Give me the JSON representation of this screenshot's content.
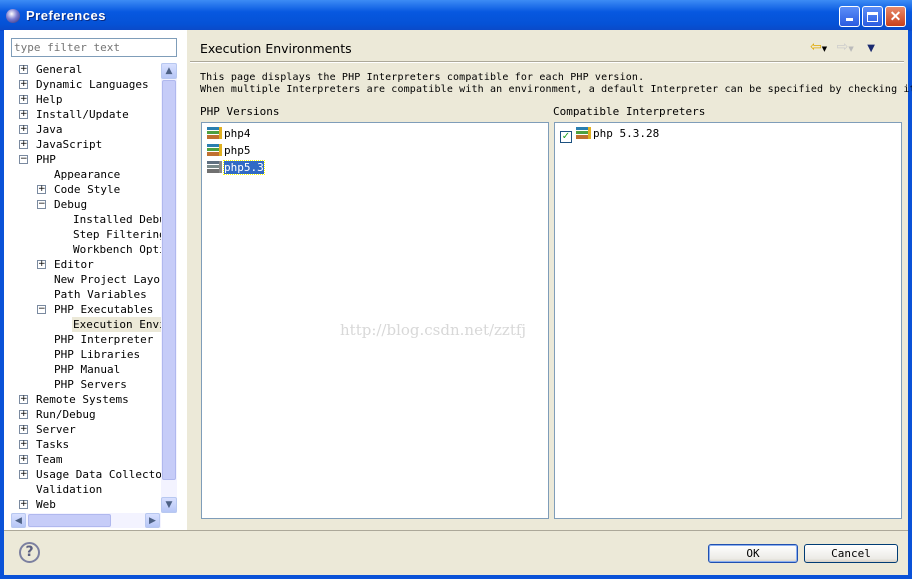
{
  "window": {
    "title": "Preferences",
    "minimize_icon": "minimize-icon",
    "maximize_icon": "maximize-icon",
    "close_icon": "close-icon"
  },
  "sidebar": {
    "filter_placeholder": "type filter text",
    "items": [
      {
        "label": "General",
        "level": 0,
        "expander": "+"
      },
      {
        "label": "Dynamic Languages",
        "level": 0,
        "expander": "+"
      },
      {
        "label": "Help",
        "level": 0,
        "expander": "+"
      },
      {
        "label": "Install/Update",
        "level": 0,
        "expander": "+"
      },
      {
        "label": "Java",
        "level": 0,
        "expander": "+"
      },
      {
        "label": "JavaScript",
        "level": 0,
        "expander": "+"
      },
      {
        "label": "PHP",
        "level": 0,
        "expander": "-"
      },
      {
        "label": "Appearance",
        "level": 1,
        "expander": ""
      },
      {
        "label": "Code Style",
        "level": 1,
        "expander": "+"
      },
      {
        "label": "Debug",
        "level": 1,
        "expander": "-"
      },
      {
        "label": "Installed Debuggers",
        "level": 2,
        "expander": ""
      },
      {
        "label": "Step Filtering",
        "level": 2,
        "expander": ""
      },
      {
        "label": "Workbench Options",
        "level": 2,
        "expander": ""
      },
      {
        "label": "Editor",
        "level": 1,
        "expander": "+"
      },
      {
        "label": "New Project Layout",
        "level": 1,
        "expander": ""
      },
      {
        "label": "Path Variables",
        "level": 1,
        "expander": ""
      },
      {
        "label": "PHP Executables",
        "level": 1,
        "expander": "-"
      },
      {
        "label": "Execution Environments",
        "level": 2,
        "expander": "",
        "selected": true
      },
      {
        "label": "PHP Interpreter",
        "level": 1,
        "expander": ""
      },
      {
        "label": "PHP Libraries",
        "level": 1,
        "expander": ""
      },
      {
        "label": "PHP Manual",
        "level": 1,
        "expander": ""
      },
      {
        "label": "PHP Servers",
        "level": 1,
        "expander": ""
      },
      {
        "label": "Remote Systems",
        "level": 0,
        "expander": "+"
      },
      {
        "label": "Run/Debug",
        "level": 0,
        "expander": "+"
      },
      {
        "label": "Server",
        "level": 0,
        "expander": "+"
      },
      {
        "label": "Tasks",
        "level": 0,
        "expander": "+"
      },
      {
        "label": "Team",
        "level": 0,
        "expander": "+"
      },
      {
        "label": "Usage Data Collector",
        "level": 0,
        "expander": "+"
      },
      {
        "label": "Validation",
        "level": 0,
        "expander": ""
      },
      {
        "label": "Web",
        "level": 0,
        "expander": "+"
      }
    ]
  },
  "page": {
    "title": "Execution Environments",
    "description": [
      "This page displays the PHP Interpreters compatible for each PHP version.",
      "When multiple Interpreters are compatible with an environment, a default Interpreter can be specified by checking it."
    ],
    "versions_label": "PHP Versions",
    "versions": [
      {
        "label": "php4"
      },
      {
        "label": "php5"
      },
      {
        "label": "php5.3",
        "selected": true
      }
    ],
    "interpreters_label": "Compatible Interpreters",
    "interpreters": [
      {
        "label": "php 5.3.28",
        "checked": true
      }
    ],
    "watermark": "http://blog.csdn.net/zztfj"
  },
  "footer": {
    "ok": "OK",
    "cancel": "Cancel",
    "help_icon": "help-icon"
  }
}
